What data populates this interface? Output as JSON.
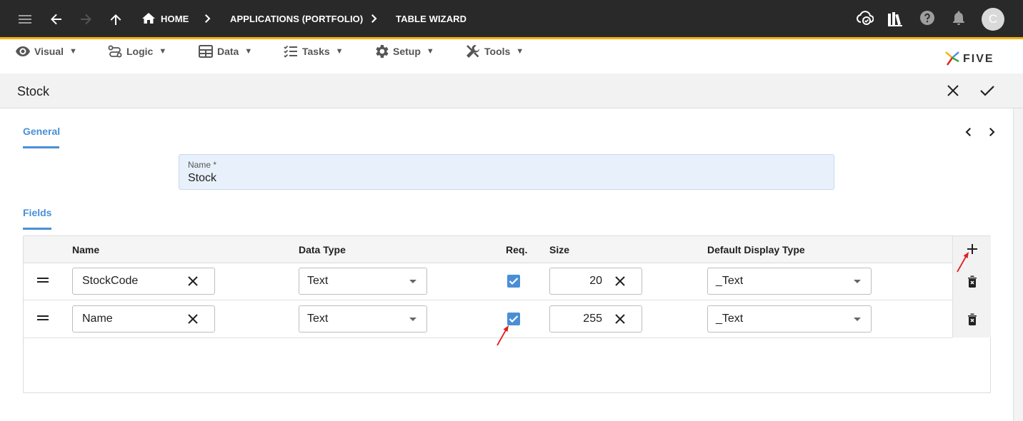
{
  "topbar": {
    "breadcrumbs": [
      "HOME",
      "APPLICATIONS (PORTFOLIO)",
      "TABLE WIZARD"
    ],
    "avatar_initial": "C",
    "icons": [
      "menu-icon",
      "back-arrow-icon",
      "forward-arrow-icon",
      "up-arrow-icon",
      "home-icon",
      "cloud-check-icon",
      "library-icon",
      "help-icon",
      "bell-icon"
    ]
  },
  "menu": {
    "items": [
      {
        "label": "Visual",
        "icon": "eye-icon"
      },
      {
        "label": "Logic",
        "icon": "flow-icon"
      },
      {
        "label": "Data",
        "icon": "table-icon"
      },
      {
        "label": "Tasks",
        "icon": "checklist-icon"
      },
      {
        "label": "Setup",
        "icon": "gear-icon"
      },
      {
        "label": "Tools",
        "icon": "tools-icon"
      }
    ],
    "caret": "▼",
    "brand": "FIVE"
  },
  "form": {
    "title": "Stock",
    "general_tab": "General",
    "name_label": "Name *",
    "name_value": "Stock",
    "fields_tab": "Fields"
  },
  "grid": {
    "columns": [
      "Name",
      "Data Type",
      "Req.",
      "Size",
      "Default Display Type"
    ],
    "rows": [
      {
        "name": "StockCode",
        "data_type": "Text",
        "required": true,
        "size": "20",
        "display_type": "_Text"
      },
      {
        "name": "Name",
        "data_type": "Text",
        "required": true,
        "size": "255",
        "display_type": "_Text"
      }
    ]
  },
  "colors": {
    "topbar": "#292929",
    "accent": "#f6b100",
    "primary": "#4a8fd6",
    "annotation": "#e02020"
  }
}
